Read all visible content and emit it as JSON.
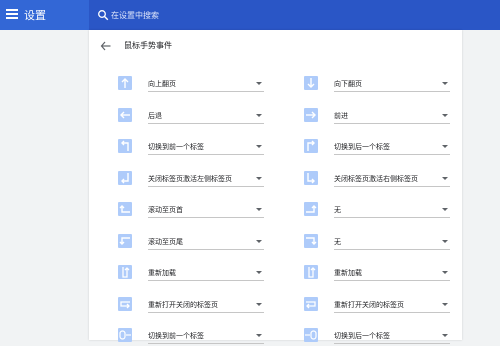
{
  "app": {
    "title": "设置"
  },
  "search": {
    "placeholder": "在设置中搜索"
  },
  "page": {
    "title": "鼠标手势事件"
  },
  "gestures": [
    {
      "icon": "arrow-up-icon",
      "action": "向上翻页"
    },
    {
      "icon": "arrow-down-icon",
      "action": "向下翻页"
    },
    {
      "icon": "arrow-left-icon",
      "action": "后退"
    },
    {
      "icon": "arrow-right-icon",
      "action": "前进"
    },
    {
      "icon": "up-left-icon",
      "action": "切换到前一个标签"
    },
    {
      "icon": "up-right-icon",
      "action": "切换到后一个标签"
    },
    {
      "icon": "down-left-icon",
      "action": "关闭标签页激活左侧标签页"
    },
    {
      "icon": "down-right-icon",
      "action": "关闭标签页激活右侧标签页"
    },
    {
      "icon": "left-up-icon",
      "action": "滚动至页首"
    },
    {
      "icon": "right-up-icon",
      "action": "无"
    },
    {
      "icon": "left-down-icon",
      "action": "滚动至页尾"
    },
    {
      "icon": "right-down-icon",
      "action": "无"
    },
    {
      "icon": "down-up-left-icon",
      "action": "重新加载"
    },
    {
      "icon": "down-up-right-icon",
      "action": "重新加载"
    },
    {
      "icon": "left-right-left-icon",
      "action": "重新打开关闭的标签页"
    },
    {
      "icon": "right-left-right-icon",
      "action": "重新打开关闭的标签页"
    },
    {
      "icon": "wheel-left-icon",
      "action": "切换到前一个标签"
    },
    {
      "icon": "wheel-right-icon",
      "action": "切换到后一个标签"
    }
  ],
  "colors": {
    "accent": "#3367d6",
    "searchbar": "#2a56c6",
    "icon_tile": "#aecbfa"
  }
}
